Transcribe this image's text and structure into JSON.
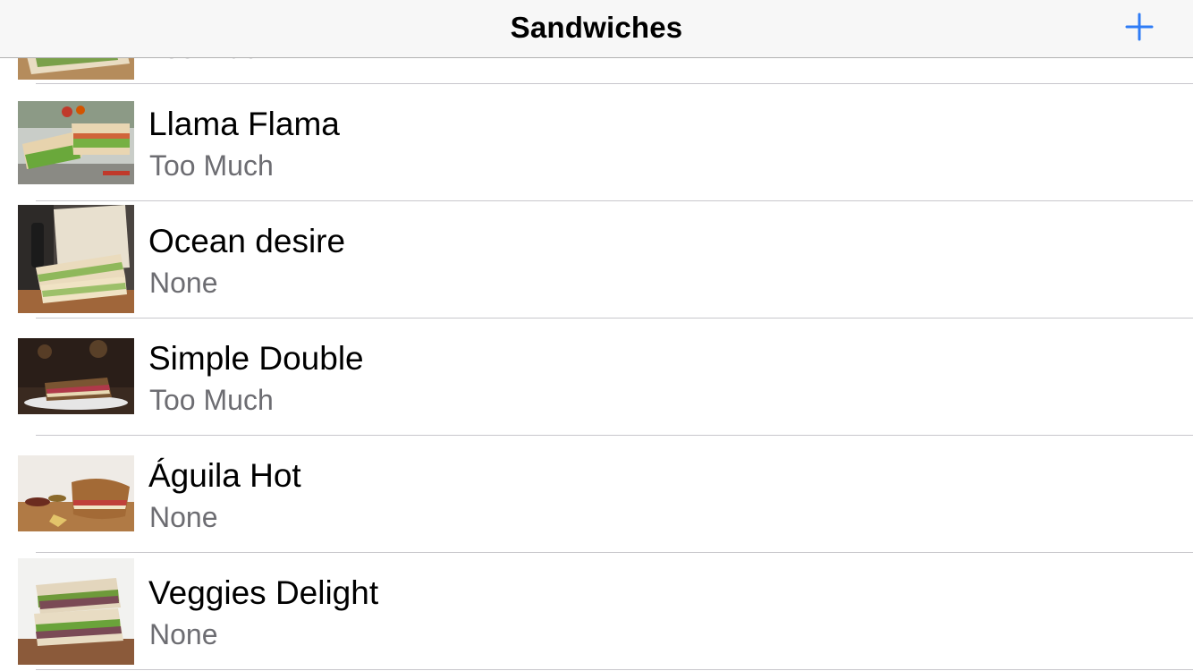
{
  "nav": {
    "title": "Sandwiches",
    "add_icon": "plus-icon",
    "accent_color": "#2f7cf6"
  },
  "rows": [
    {
      "title": "",
      "subtitle": "Too Much",
      "image": "sandwich-photo"
    },
    {
      "title": "Llama Flama",
      "subtitle": "Too Much",
      "image": "sandwich-photo"
    },
    {
      "title": "Ocean desire",
      "subtitle": "None",
      "image": "sandwich-photo"
    },
    {
      "title": "Simple Double",
      "subtitle": "Too Much",
      "image": "sandwich-photo"
    },
    {
      "title": "Águila Hot",
      "subtitle": "None",
      "image": "sandwich-photo"
    },
    {
      "title": "Veggies Delight",
      "subtitle": "None",
      "image": "sandwich-photo"
    }
  ]
}
